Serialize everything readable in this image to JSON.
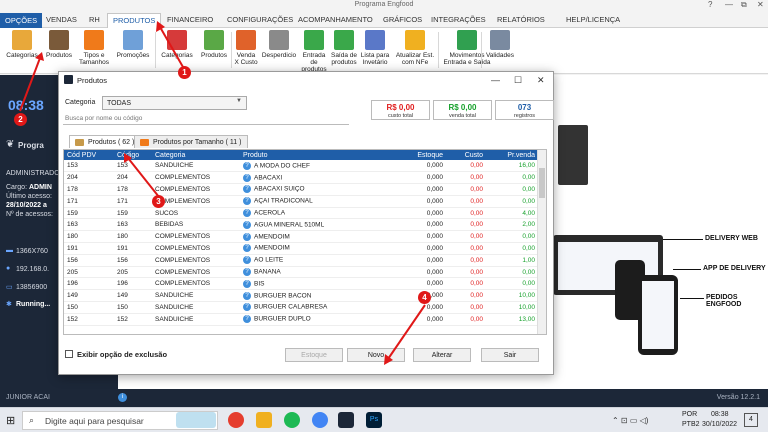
{
  "window": {
    "title": "Programa Engfood",
    "controls": [
      "?",
      "—",
      "⧉",
      "✕"
    ]
  },
  "menu": {
    "tabs": [
      "OPÇÕES",
      "VENDAS",
      "RH",
      "PRODUTOS",
      "FINANCEIRO",
      "CONFIGURAÇÕES",
      "ACOMPANHAMENTO",
      "GRÁFICOS",
      "INTEGRAÇÕES",
      "RELATÓRIOS",
      "HELP/LICENÇA"
    ],
    "active": "PRODUTOS"
  },
  "ribbon": {
    "buttons": [
      {
        "l1": "Categorias",
        "l2": "",
        "color": "#e8a83a"
      },
      {
        "l1": "Produtos",
        "l2": "",
        "color": "#7a5a3a"
      },
      {
        "l1": "Tipos e",
        "l2": "Tamanhos",
        "color": "#f07a1a"
      },
      {
        "l1": "Promoções",
        "l2": "",
        "color": "#6fa0d8"
      },
      {
        "l1": "Categorias",
        "l2": "",
        "color": "#d63a3a"
      },
      {
        "l1": "Produtos",
        "l2": "",
        "color": "#5aa846"
      },
      {
        "l1": "Venda",
        "l2": "X Custo",
        "color": "#e0622a"
      },
      {
        "l1": "Desperdicio",
        "l2": "",
        "color": "#8a8a8a"
      },
      {
        "l1": "Entrada de",
        "l2": "produtos",
        "color": "#3aa84a"
      },
      {
        "l1": "Saída de",
        "l2": "produtos",
        "color": "#3aa84a"
      },
      {
        "l1": "Lista para",
        "l2": "Invetário",
        "color": "#5a78c8"
      },
      {
        "l1": "Atualizar Est.",
        "l2": "com NFe",
        "color": "#f0b020"
      },
      {
        "l1": "Movimentos",
        "l2": "Entrada e Saída",
        "color": "#30a050"
      },
      {
        "l1": "Validades",
        "l2": "",
        "color": "#7a8aa0"
      }
    ]
  },
  "sidebar": {
    "clock": "08:38",
    "program": "Progra",
    "admin": "ADMINISTRADO",
    "cargo": "Cargo:",
    "cargo_val": "ADMIN",
    "ultimo": "Último acesso:",
    "ultimo_val": "28/10/2022 a",
    "acessos": "Nº de acessos:",
    "screen": "1366X760",
    "ip": "192.168.0.",
    "phone": "13856900",
    "running": "Running..."
  },
  "promo": {
    "web": "DELIVERY WEB",
    "app": "APP DE DELIVERY",
    "pedidos": "PEDIDOS ENGFOOD"
  },
  "statusbar": {
    "company": "JUNIOR ACAI",
    "version": "Versão  12.2.1"
  },
  "taskbar": {
    "search": "Digite aqui para pesquisar",
    "lang": "POR",
    "layout": "PTB2",
    "time": "08:38",
    "date": "30/10/2022",
    "notif": "4"
  },
  "dialog": {
    "title": "Produtos",
    "category_label": "Categoria",
    "category_value": "TODAS",
    "search_placeholder": "Busca por nome ou código",
    "stats": [
      {
        "value": "R$ 0,00",
        "caption": "custo total",
        "color": "#e02020"
      },
      {
        "value": "R$ 0,00",
        "caption": "venda total",
        "color": "#17a12c"
      },
      {
        "value": "073",
        "caption": "registros",
        "color": "#1f5ea8"
      }
    ],
    "tabs": [
      "Produtos ( 62 )",
      "Produtos por Tamanho ( 11 )"
    ],
    "columns": [
      "Cód PDV",
      "Código",
      "Categoria",
      "Produto",
      "Estoque",
      "Custo",
      "Pr.venda"
    ],
    "rows": [
      [
        "153",
        "153",
        "SANDUICHE",
        "A MODA DO CHEF",
        "0,000",
        "0,00",
        "16,00"
      ],
      [
        "204",
        "204",
        "COMPLEMENTOS",
        "ABACAXI",
        "0,000",
        "0,00",
        "0,00"
      ],
      [
        "178",
        "178",
        "COMPLEMENTOS",
        "ABACAXI SUIÇO",
        "0,000",
        "0,00",
        "0,00"
      ],
      [
        "171",
        "171",
        "COMPLEMENTOS",
        "AÇAI TRADICONAL",
        "0,000",
        "0,00",
        "0,00"
      ],
      [
        "159",
        "159",
        "SUCOS",
        "ACEROLA",
        "0,000",
        "0,00",
        "4,00"
      ],
      [
        "163",
        "163",
        "BEBIDAS",
        "AGUA MINERAL 510ML",
        "0,000",
        "0,00",
        "2,00"
      ],
      [
        "180",
        "180",
        "COMPLEMENTOS",
        "AMENDOIM",
        "0,000",
        "0,00",
        "0,00"
      ],
      [
        "191",
        "191",
        "COMPLEMENTOS",
        "AMENDOIM",
        "0,000",
        "0,00",
        "0,00"
      ],
      [
        "156",
        "156",
        "COMPLEMENTOS",
        "AO LEITE",
        "0,000",
        "0,00",
        "1,00"
      ],
      [
        "205",
        "205",
        "COMPLEMENTOS",
        "BANANA",
        "0,000",
        "0,00",
        "0,00"
      ],
      [
        "196",
        "196",
        "COMPLEMENTOS",
        "BIS",
        "0,000",
        "0,00",
        "0,00"
      ],
      [
        "149",
        "149",
        "SANDUICHE",
        "BURGUER BACON",
        "0,000",
        "0,00",
        "10,00"
      ],
      [
        "150",
        "150",
        "SANDUICHE",
        "BURGUER CALABRESA",
        "0,000",
        "0,00",
        "10,00"
      ],
      [
        "152",
        "152",
        "SANDUICHE",
        "BURGUER DUPLO",
        "0,000",
        "0,00",
        "13,00"
      ]
    ],
    "exclusion_label": "Exibir opção de exclusão",
    "buttons": {
      "estoque": "Estoque",
      "novo": "Novo",
      "alterar": "Alterar",
      "sair": "Sair"
    }
  },
  "markers": [
    "1",
    "2",
    "3",
    "4"
  ]
}
